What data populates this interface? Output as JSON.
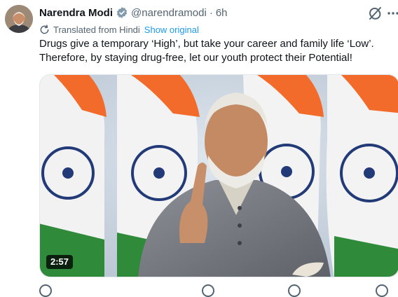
{
  "tweet": {
    "author_name": "Narendra Modi",
    "handle": "@narendramodi",
    "separator": "·",
    "time": "6h",
    "translation_note": "Translated from Hindi",
    "show_original_label": "Show original",
    "text": "Drugs give a temporary ‘High’, but take your career and family life ‘Low’. Therefore, by staying drug-free, let our youth protect their Potential!"
  },
  "video": {
    "duration": "2:57"
  },
  "icons": {
    "verified": "verified-badge-icon",
    "grok": "grok-icon",
    "more": "more-options-icon",
    "translate": "translate-icon"
  },
  "colors": {
    "accent": "#1d9bf0",
    "secondary_text": "#536471",
    "primary_text": "#0f1419"
  }
}
